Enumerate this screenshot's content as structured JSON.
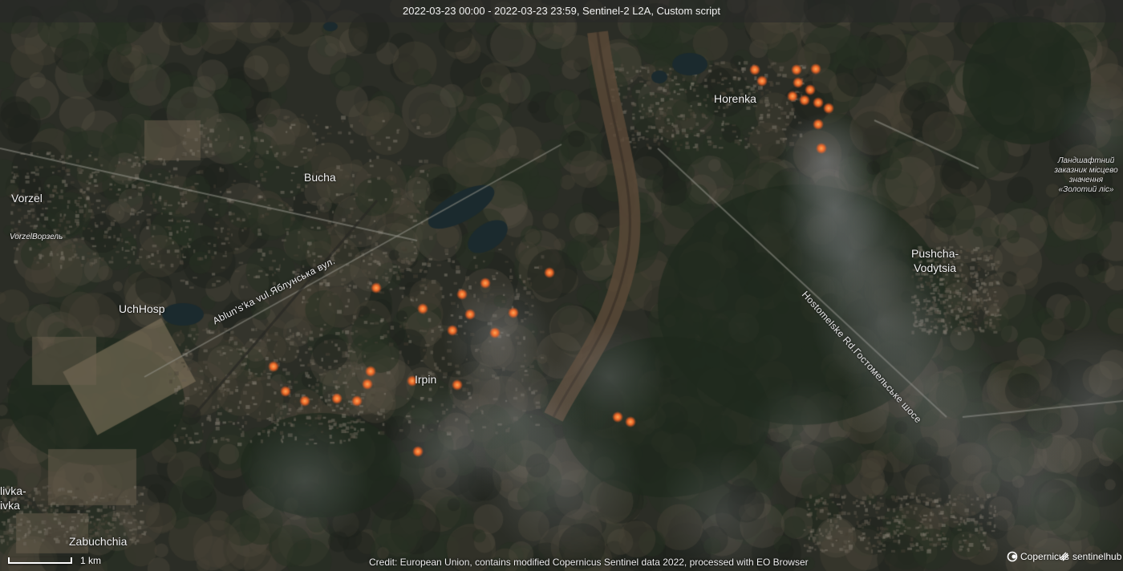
{
  "header": {
    "title": "2022-03-23 00:00 - 2022-03-23 23:59, Sentinel-2 L2A, Custom script"
  },
  "places": {
    "horenka": "Horenka",
    "bucha": "Bucha",
    "vorzel": "Vorzel",
    "vorzel_alt": "VorzelВорзель",
    "uchhosp": "UchHosp",
    "irpin": "Irpin",
    "pushcha_line1": "Pushcha-",
    "pushcha_line2": "Vodytsia",
    "zabuchchia": "Zabuchchia",
    "edge_line1": "livka-",
    "edge_line2": "ivka",
    "reserve_line1": "Ландшафтний",
    "reserve_line2": "заказник місцево",
    "reserve_line3": "значення",
    "reserve_line4": "«Золотий ліс»"
  },
  "roads": {
    "ablunska": "Ablun's'ka vul.Яблунська вул.",
    "hostomelske": "Hostomelske Rd.Гостомельське шосе"
  },
  "scale": {
    "label": "1 km"
  },
  "credit": "Credit: European Union, contains modified Copernicus Sentinel data 2022, processed with EO Browser",
  "logos": {
    "copernicus": "Copernicus",
    "sentinelhub": "sentinelhub"
  },
  "map": {
    "fire_color": "#ff7a2a",
    "smoke_color": "#8a8d90",
    "water_color": "#1d2c30",
    "forest_color": "#233020",
    "urban_color": "#4a4438"
  }
}
